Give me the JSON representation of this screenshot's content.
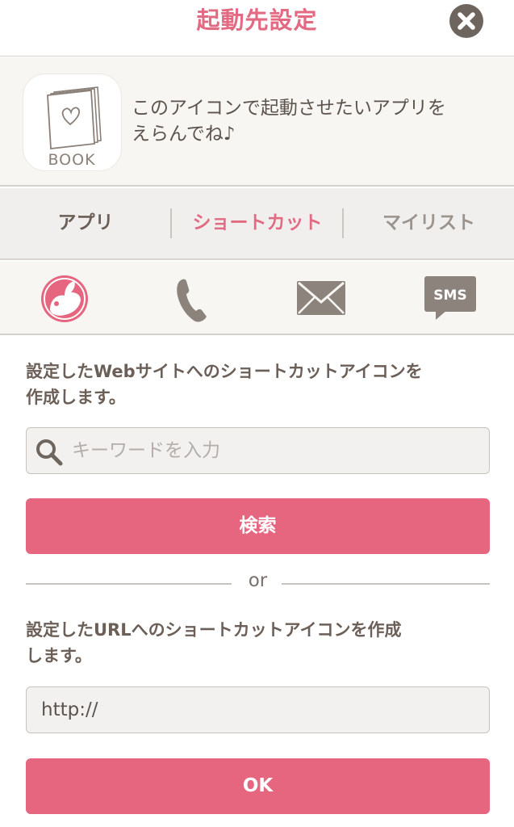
{
  "header": {
    "title": "起動先設定",
    "close_icon": "close-icon"
  },
  "intro": {
    "app_icon_label": "BOOK",
    "message_line1": "このアイコンで起動させたいアプリを",
    "message_line2": "えらんでね♪"
  },
  "tabs": [
    {
      "label": "アプリ",
      "selected": false
    },
    {
      "label": "ショートカット",
      "selected": true
    },
    {
      "label": "マイリスト",
      "selected": false
    }
  ],
  "shortcut_types": [
    {
      "icon": "web-globe-icon",
      "selected": true
    },
    {
      "icon": "phone-icon",
      "selected": false
    },
    {
      "icon": "mail-icon",
      "selected": false
    },
    {
      "icon": "sms-icon",
      "label": "SMS",
      "selected": false
    }
  ],
  "web_section": {
    "description_line1": "設定したWebサイトへのショートカットアイコンを",
    "description_line2": "作成します。",
    "search_placeholder": "キーワードを入力",
    "search_button": "検索"
  },
  "divider_text": "or",
  "url_section": {
    "description_line1": "設定したURLへのショートカットアイコンを作成",
    "description_line2": "します。",
    "url_value": "http://",
    "ok_button": "OK"
  },
  "colors": {
    "accent": "#e6657f",
    "title": "#e36a83",
    "text": "#6b5f57",
    "icon_gray": "#8c837d"
  }
}
